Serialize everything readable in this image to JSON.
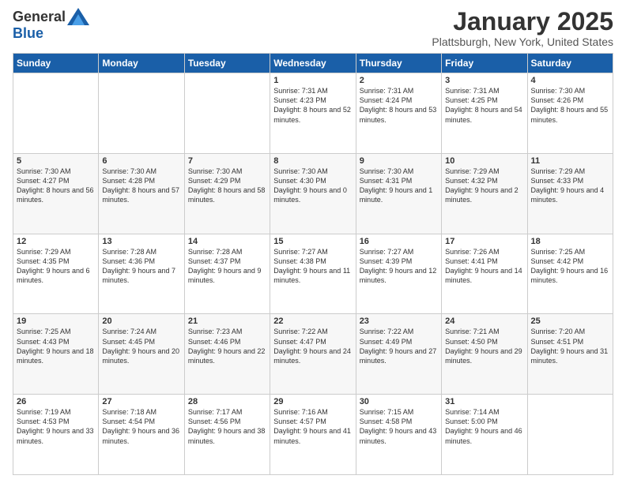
{
  "header": {
    "logo_general": "General",
    "logo_blue": "Blue",
    "month_title": "January 2025",
    "location": "Plattsburgh, New York, United States"
  },
  "days_of_week": [
    "Sunday",
    "Monday",
    "Tuesday",
    "Wednesday",
    "Thursday",
    "Friday",
    "Saturday"
  ],
  "weeks": [
    [
      {
        "day": "",
        "info": ""
      },
      {
        "day": "",
        "info": ""
      },
      {
        "day": "",
        "info": ""
      },
      {
        "day": "1",
        "info": "Sunrise: 7:31 AM\nSunset: 4:23 PM\nDaylight: 8 hours and 52 minutes."
      },
      {
        "day": "2",
        "info": "Sunrise: 7:31 AM\nSunset: 4:24 PM\nDaylight: 8 hours and 53 minutes."
      },
      {
        "day": "3",
        "info": "Sunrise: 7:31 AM\nSunset: 4:25 PM\nDaylight: 8 hours and 54 minutes."
      },
      {
        "day": "4",
        "info": "Sunrise: 7:30 AM\nSunset: 4:26 PM\nDaylight: 8 hours and 55 minutes."
      }
    ],
    [
      {
        "day": "5",
        "info": "Sunrise: 7:30 AM\nSunset: 4:27 PM\nDaylight: 8 hours and 56 minutes."
      },
      {
        "day": "6",
        "info": "Sunrise: 7:30 AM\nSunset: 4:28 PM\nDaylight: 8 hours and 57 minutes."
      },
      {
        "day": "7",
        "info": "Sunrise: 7:30 AM\nSunset: 4:29 PM\nDaylight: 8 hours and 58 minutes."
      },
      {
        "day": "8",
        "info": "Sunrise: 7:30 AM\nSunset: 4:30 PM\nDaylight: 9 hours and 0 minutes."
      },
      {
        "day": "9",
        "info": "Sunrise: 7:30 AM\nSunset: 4:31 PM\nDaylight: 9 hours and 1 minute."
      },
      {
        "day": "10",
        "info": "Sunrise: 7:29 AM\nSunset: 4:32 PM\nDaylight: 9 hours and 2 minutes."
      },
      {
        "day": "11",
        "info": "Sunrise: 7:29 AM\nSunset: 4:33 PM\nDaylight: 9 hours and 4 minutes."
      }
    ],
    [
      {
        "day": "12",
        "info": "Sunrise: 7:29 AM\nSunset: 4:35 PM\nDaylight: 9 hours and 6 minutes."
      },
      {
        "day": "13",
        "info": "Sunrise: 7:28 AM\nSunset: 4:36 PM\nDaylight: 9 hours and 7 minutes."
      },
      {
        "day": "14",
        "info": "Sunrise: 7:28 AM\nSunset: 4:37 PM\nDaylight: 9 hours and 9 minutes."
      },
      {
        "day": "15",
        "info": "Sunrise: 7:27 AM\nSunset: 4:38 PM\nDaylight: 9 hours and 11 minutes."
      },
      {
        "day": "16",
        "info": "Sunrise: 7:27 AM\nSunset: 4:39 PM\nDaylight: 9 hours and 12 minutes."
      },
      {
        "day": "17",
        "info": "Sunrise: 7:26 AM\nSunset: 4:41 PM\nDaylight: 9 hours and 14 minutes."
      },
      {
        "day": "18",
        "info": "Sunrise: 7:25 AM\nSunset: 4:42 PM\nDaylight: 9 hours and 16 minutes."
      }
    ],
    [
      {
        "day": "19",
        "info": "Sunrise: 7:25 AM\nSunset: 4:43 PM\nDaylight: 9 hours and 18 minutes."
      },
      {
        "day": "20",
        "info": "Sunrise: 7:24 AM\nSunset: 4:45 PM\nDaylight: 9 hours and 20 minutes."
      },
      {
        "day": "21",
        "info": "Sunrise: 7:23 AM\nSunset: 4:46 PM\nDaylight: 9 hours and 22 minutes."
      },
      {
        "day": "22",
        "info": "Sunrise: 7:22 AM\nSunset: 4:47 PM\nDaylight: 9 hours and 24 minutes."
      },
      {
        "day": "23",
        "info": "Sunrise: 7:22 AM\nSunset: 4:49 PM\nDaylight: 9 hours and 27 minutes."
      },
      {
        "day": "24",
        "info": "Sunrise: 7:21 AM\nSunset: 4:50 PM\nDaylight: 9 hours and 29 minutes."
      },
      {
        "day": "25",
        "info": "Sunrise: 7:20 AM\nSunset: 4:51 PM\nDaylight: 9 hours and 31 minutes."
      }
    ],
    [
      {
        "day": "26",
        "info": "Sunrise: 7:19 AM\nSunset: 4:53 PM\nDaylight: 9 hours and 33 minutes."
      },
      {
        "day": "27",
        "info": "Sunrise: 7:18 AM\nSunset: 4:54 PM\nDaylight: 9 hours and 36 minutes."
      },
      {
        "day": "28",
        "info": "Sunrise: 7:17 AM\nSunset: 4:56 PM\nDaylight: 9 hours and 38 minutes."
      },
      {
        "day": "29",
        "info": "Sunrise: 7:16 AM\nSunset: 4:57 PM\nDaylight: 9 hours and 41 minutes."
      },
      {
        "day": "30",
        "info": "Sunrise: 7:15 AM\nSunset: 4:58 PM\nDaylight: 9 hours and 43 minutes."
      },
      {
        "day": "31",
        "info": "Sunrise: 7:14 AM\nSunset: 5:00 PM\nDaylight: 9 hours and 46 minutes."
      },
      {
        "day": "",
        "info": ""
      }
    ]
  ]
}
